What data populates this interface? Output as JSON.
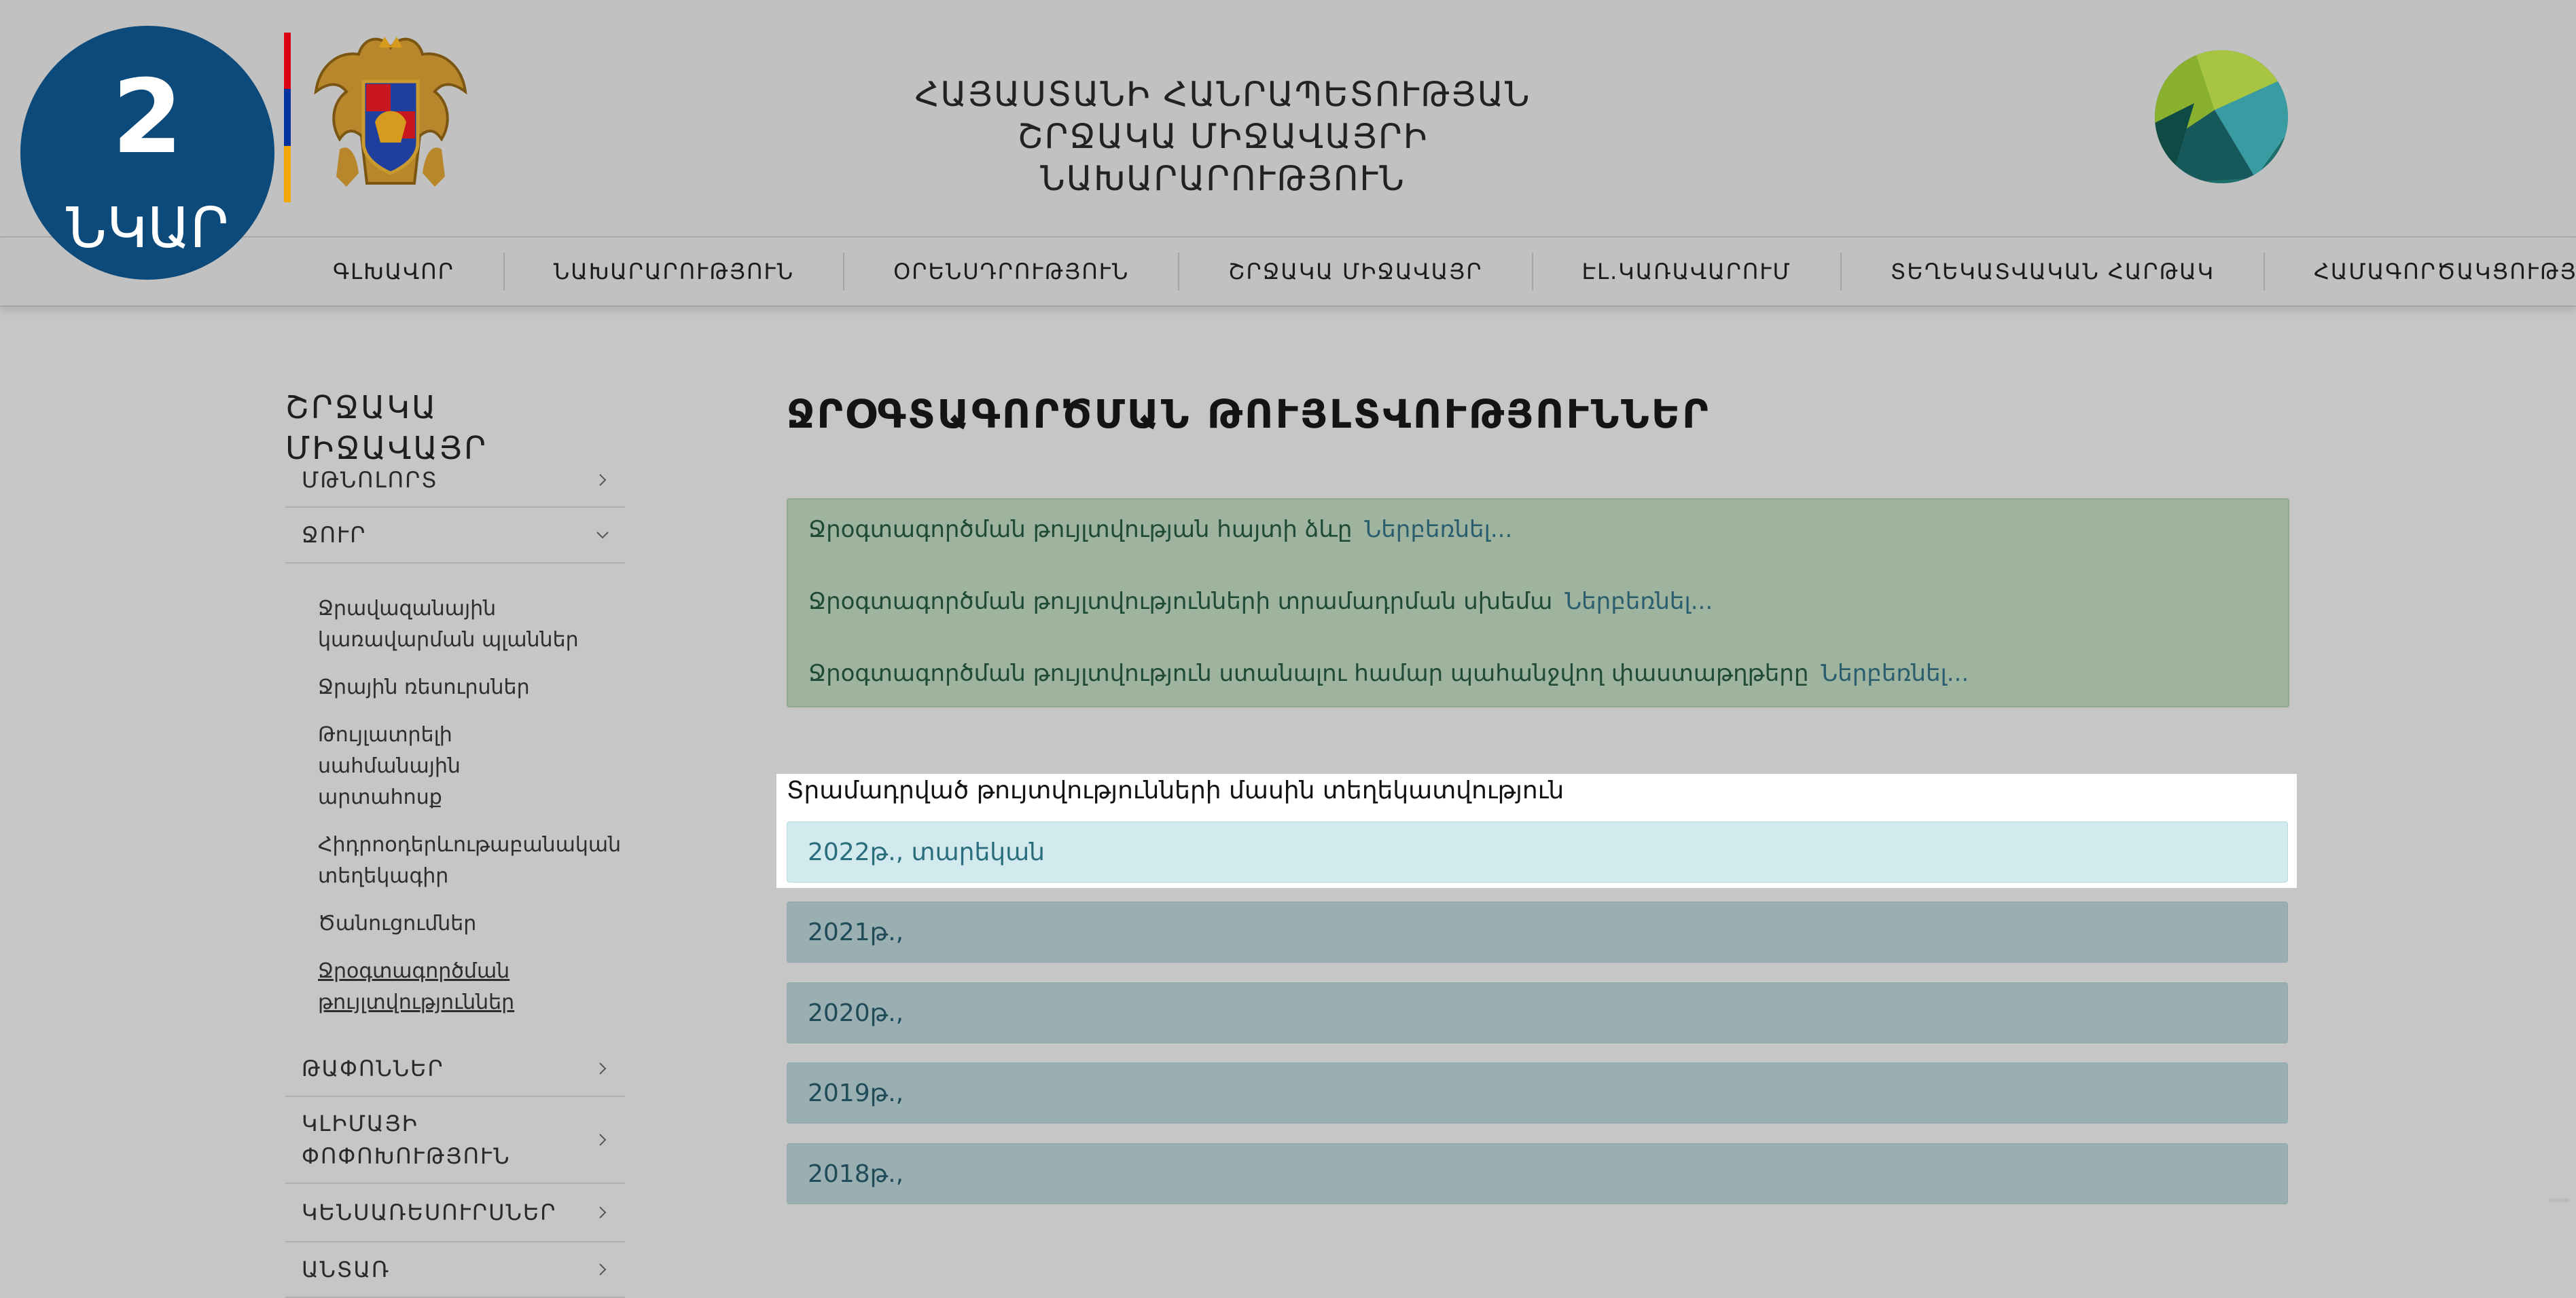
{
  "badge": {
    "number": "2",
    "word": "ՆԿԱՐ"
  },
  "flag_colors": [
    "#d90012",
    "#0033a0",
    "#f2a800"
  ],
  "header": {
    "title_line1": "ՀԱՅԱՍՏԱՆԻ ՀԱՆՐԱՊԵՏՈՒԹՅԱՆ",
    "title_line2": "ՇՐՋԱԿԱ ՄԻՋԱՎԱՅՐԻ ՆԱԽԱՐԱՐՈՒԹՅՈՒՆ"
  },
  "nav": {
    "items": [
      "ԳԼԽԱՎՈՐ",
      "ՆԱԽԱՐԱՐՈՒԹՅՈՒՆ",
      "ՕՐԵՆՍԴՐՈՒԹՅՈՒՆ",
      "ՇՐՋԱԿԱ ՄԻՋԱՎԱՅՐ",
      "ԷԼ.ԿԱՌԱՎԱՐՈՒՄ",
      "ՏԵՂԵԿԱՏՎԱԿԱՆ ՀԱՐԹԱԿ",
      "ՀԱՄԱԳՈՐԾԱԿՑՈՒԹՅՈՒՆ"
    ]
  },
  "sidebar": {
    "title": "ՇՐՋԱԿԱ ՄԻՋԱՎԱՅՐ",
    "items": [
      {
        "label": "ՄԹՆՈԼՈՐՏ",
        "icon": "chevron-right-icon"
      },
      {
        "label": "ՋՈՒՐ",
        "icon": "chevron-down-icon"
      },
      {
        "label": "ԹԱՓՈՆՆԵՐ",
        "icon": "chevron-right-icon"
      },
      {
        "label": "ԿԼԻՄԱՅԻ ՓՈՓՈԽՈՒԹՅՈՒՆ",
        "icon": "chevron-right-icon"
      },
      {
        "label": "ԿԵՆՍԱՌԵՍՈՒՐՍՆԵՐ",
        "icon": "chevron-right-icon"
      },
      {
        "label": "ԱՆՏԱՌ",
        "icon": "chevron-right-icon"
      }
    ],
    "water_sub_items": [
      "Ջրավազանային կառավարման պլաններ",
      "Ջրային ռեսուրսներ",
      "Թույլատրելի սահմանային արտահոսք",
      "Հիդրոօդերևութաբանական տեղեկագիր",
      "Ծանուցումներ",
      "Ջրօգտագործման թույլտվություններ"
    ]
  },
  "main": {
    "title": "ՋՐՕԳՏԱԳՈՐԾՄԱՆ ԹՈՒՅԼՏՎՈՒԹՅՈՒՆՆԵՐ",
    "info_lines": [
      {
        "text": "Ջրօգտագործման թույլտվության հայտի ձևը",
        "more": "Ներբեռնել..."
      },
      {
        "text": "Ջրօգտագործման թույլտվությունների տրամադրման սխեմա",
        "more": "Ներբեռնել..."
      },
      {
        "text": "Ջրօգտագործման թույլտվություն ստանալու համար պահանջվող փաստաթղթերը",
        "more": "Ներբեռնել..."
      }
    ],
    "issued_heading": "Տրամադրված թույտվությունների մասին տեղեկատվություն",
    "years": [
      "2022թ., տարեկան",
      "2021թ.,",
      "2020թ.,",
      "2019թ.,",
      "2018թ.,"
    ]
  }
}
